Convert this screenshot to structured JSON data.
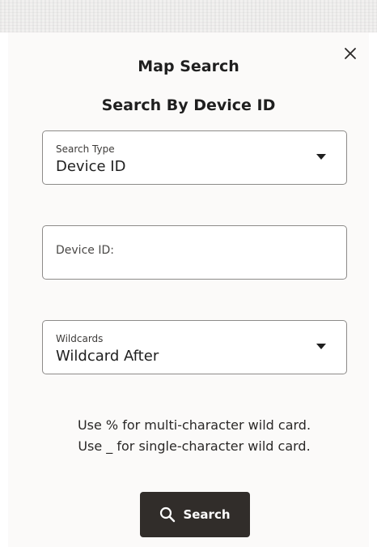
{
  "dialog": {
    "title": "Map Search",
    "subtitle": "Search By Device ID",
    "close_icon": "close-icon"
  },
  "search_type": {
    "label": "Search Type",
    "value": "Device ID",
    "icon": "dropdown-caret-icon"
  },
  "device_id": {
    "placeholder": "Device ID:",
    "value": ""
  },
  "wildcards": {
    "label": "Wildcards",
    "value": "Wildcard After",
    "icon": "dropdown-caret-icon"
  },
  "help": {
    "line1": "Use % for multi-character wild card.",
    "line2": "Use _ for single-character wild card."
  },
  "search_button": {
    "label": "Search",
    "icon": "search-icon"
  },
  "colors": {
    "button_bg": "#312d2a",
    "panel_bg": "#fbfaf9",
    "field_border": "#8d8b89"
  }
}
